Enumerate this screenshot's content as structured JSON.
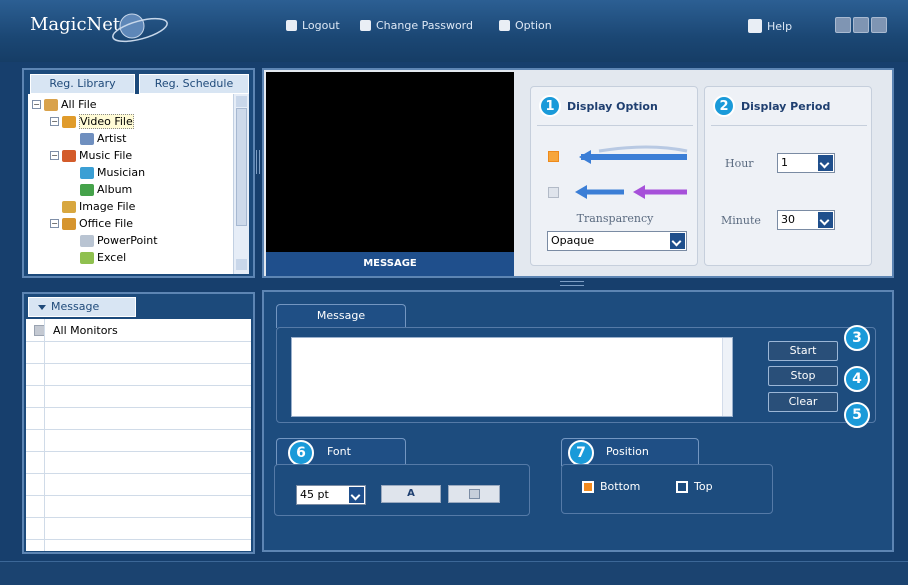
{
  "app": {
    "logo": "MagicNet X"
  },
  "topnav": {
    "logout": "Logout",
    "change_password": "Change Password",
    "option": "Option",
    "help": "Help"
  },
  "library": {
    "tabs": [
      "Reg. Library",
      "Reg. Schedule"
    ],
    "tree": [
      {
        "label": "All File",
        "level": 0,
        "expander": "minus",
        "icon_color": "#d9a24b"
      },
      {
        "label": "Video File",
        "level": 1,
        "expander": "minus",
        "icon_color": "#e09b2b",
        "selected": true
      },
      {
        "label": "Artist",
        "level": 2,
        "expander": "",
        "icon_color": "#6f8fbf"
      },
      {
        "label": "Music File",
        "level": 1,
        "expander": "minus",
        "icon_color": "#d35b2a"
      },
      {
        "label": "Musician",
        "level": 2,
        "expander": "",
        "icon_color": "#3b9fd4"
      },
      {
        "label": "Album",
        "level": 2,
        "expander": "",
        "icon_color": "#45a24a"
      },
      {
        "label": "Image File",
        "level": 1,
        "expander": "",
        "icon_color": "#d8a73f"
      },
      {
        "label": "Office File",
        "level": 1,
        "expander": "minus",
        "icon_color": "#d6952e"
      },
      {
        "label": "PowerPoint",
        "level": 2,
        "expander": "",
        "icon_color": "#b9c4d2"
      },
      {
        "label": "Excel",
        "level": 2,
        "expander": "",
        "icon_color": "#8fc04f"
      }
    ]
  },
  "message_list": {
    "tab": "Message",
    "items": [
      "All Monitors"
    ]
  },
  "preview": {
    "label": "MESSAGE"
  },
  "display_option": {
    "badge": "1",
    "title": "Display Option",
    "transparency_label": "Transparency",
    "transparency_value": "Opaque"
  },
  "display_period": {
    "badge": "2",
    "title": "Display Period",
    "hour_label": "Hour",
    "hour_value": "1",
    "minute_label": "Minute",
    "minute_value": "30"
  },
  "message_editor": {
    "tab": "Message",
    "text": ""
  },
  "actions": [
    {
      "label": "Start",
      "badge": "3"
    },
    {
      "label": "Stop",
      "badge": "4"
    },
    {
      "label": "Clear",
      "badge": "5"
    }
  ],
  "font": {
    "badge": "6",
    "title": "Font",
    "size": "45 pt",
    "bold_label": "A"
  },
  "position": {
    "badge": "7",
    "title": "Position",
    "bottom_label": "Bottom",
    "top_label": "Top",
    "selected": "Bottom"
  },
  "colors": {
    "accent": "#1a9ad9",
    "panel": "#1d4c7e",
    "background": "#173f6d"
  }
}
